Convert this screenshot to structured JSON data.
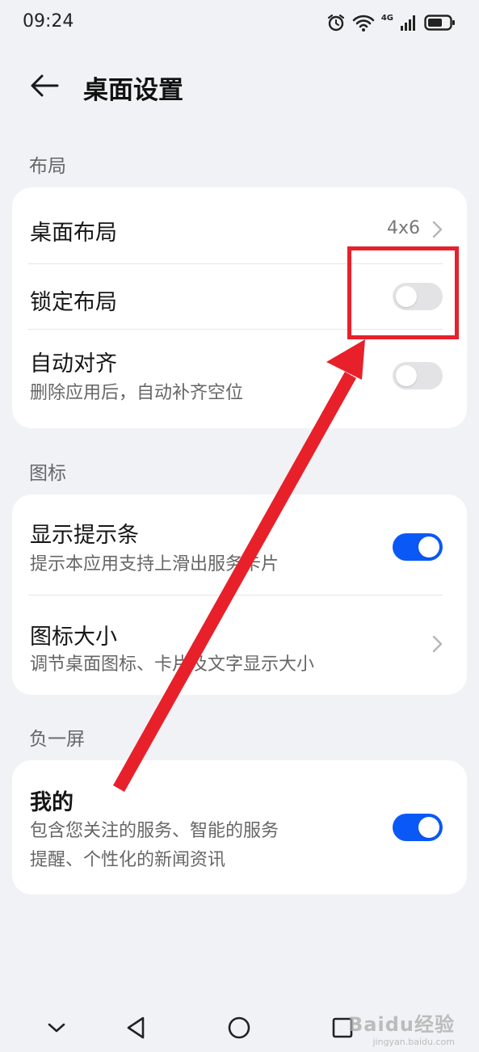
{
  "status_bar": {
    "time": "09:24",
    "network_label": "4G",
    "icons": [
      "alarm-icon",
      "wifi-icon",
      "signal-icon",
      "battery-icon"
    ]
  },
  "header": {
    "back_icon": "arrow-left-icon",
    "title": "桌面设置"
  },
  "sections": {
    "layout": {
      "label": "布局",
      "desktop_layout": {
        "title": "桌面布局",
        "value": "4x6"
      },
      "lock_layout": {
        "title": "锁定布局",
        "enabled": false
      },
      "auto_align": {
        "title": "自动对齐",
        "subtitle": "删除应用后，自动补齐空位",
        "enabled": false
      }
    },
    "icons": {
      "label": "图标",
      "show_hint_bar": {
        "title": "显示提示条",
        "subtitle": "提示本应用支持上滑出服务卡片",
        "enabled": true
      },
      "icon_size": {
        "title": "图标大小",
        "subtitle": "调节桌面图标、卡片及文字显示大小"
      }
    },
    "minus_one_screen": {
      "label": "负一屏",
      "mine": {
        "title": "我的",
        "subtitle_line1": "包含您关注的服务、智能的服务",
        "subtitle_line2": "提醒、个性化的新闻资讯",
        "enabled": true
      }
    }
  },
  "colors": {
    "accent": "#0a59f7",
    "toggle_off": "#e3e3e6",
    "annotation": "#e8202a",
    "background": "#f1f2f5"
  },
  "nav_bar": {
    "icons": [
      "chevron-down-icon",
      "back-triangle-icon",
      "home-circle-icon",
      "recents-square-icon"
    ]
  },
  "watermark": {
    "brand": "Baidu经验",
    "url": "jingyan.baidu.com"
  }
}
